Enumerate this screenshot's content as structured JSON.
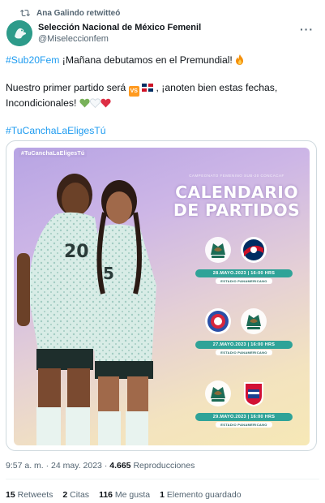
{
  "retweet": {
    "label": "Ana Galindo retwitteó"
  },
  "author": {
    "display_name": "Selección Nacional de México Femenil",
    "handle": "@Miseleccionfem"
  },
  "tweet": {
    "line1_hashtag": "#Sub20Fem",
    "line1_text": " ¡Mañana debutamos en el Premundial! ",
    "line2_text_a": "Nuestro primer partido será ",
    "line2_text_b": " , ¡anoten bien estas fechas, Incondicionales! ",
    "hashtag": "#TuCanchaLaEligesTú"
  },
  "media": {
    "tag": "#TuCanchaLaEligesTú",
    "championship": "CAMPEONATO FEMENINO SUB-20 CONCACAF",
    "title_line1": "CALENDARIO",
    "title_line2": "DE PARTIDOS",
    "jersey_left": "20",
    "jersey_right": "5",
    "matches": [
      {
        "date": "28.MAYO.2023 | 16:00 HRS",
        "venue": "ESTADIO PANAMERICANO",
        "home": "mexico-crest-icon",
        "away": "dominican-republic-crest-icon"
      },
      {
        "date": "27.MAYO.2023 | 16:00 HRS",
        "venue": "ESTADIO PANAMERICANO",
        "home": "puerto-rico-crest-icon",
        "away": "mexico-crest-icon"
      },
      {
        "date": "29.MAYO.2023 | 16:00 HRS",
        "venue": "ESTADIO PANAMERICANO",
        "home": "mexico-crest-icon",
        "away": "costa-rica-crest-icon"
      }
    ]
  },
  "meta": {
    "time": "9:57 a. m.",
    "separator": " · ",
    "date": "24 may. 2023",
    "views_count": "4.665",
    "views_label": " Reproducciones"
  },
  "stats": {
    "retweets_count": "15",
    "retweets_label": " Retweets",
    "quotes_count": "2",
    "quotes_label": " Citas",
    "likes_count": "116",
    "likes_label": " Me gusta",
    "bookmarks_count": "1",
    "bookmarks_label": " Elemento guardado"
  },
  "colors": {
    "link": "#1d9bf0",
    "muted": "#536471",
    "pill": "#2fa398",
    "avatar": "#2d9b8a"
  }
}
